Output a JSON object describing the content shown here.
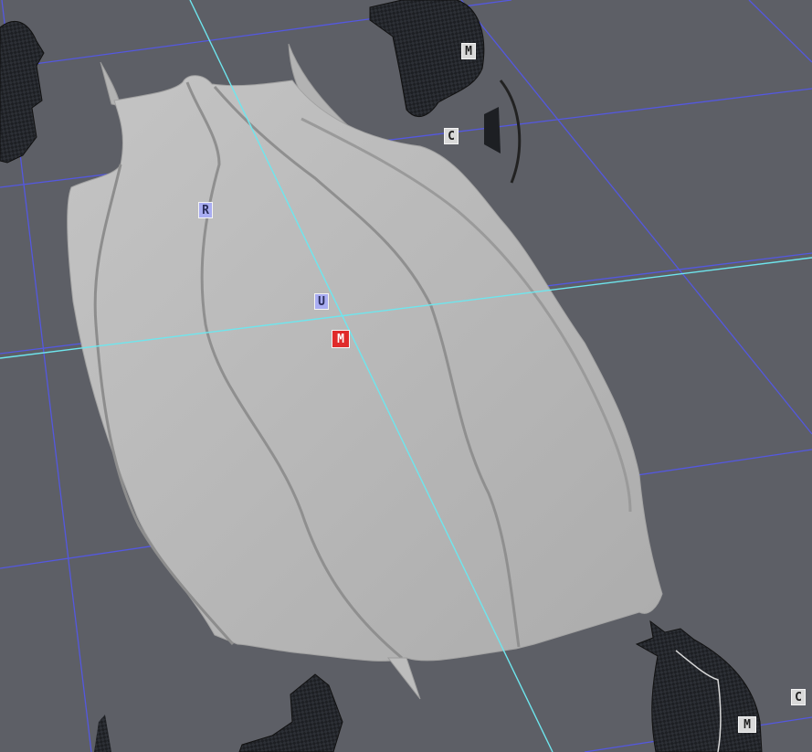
{
  "viewport": {
    "background": "#5d5f66",
    "grid_color": "#5458e0",
    "axis_color": "#6ee6ee",
    "part_color": "#bababa",
    "carbon_color": "#1d1f23"
  },
  "markers": {
    "top_mount": {
      "label": "M",
      "kind": "neutral"
    },
    "top_connector": {
      "label": "C",
      "kind": "neutral"
    },
    "rotate_handle": {
      "label": "R",
      "kind": "blue"
    },
    "up_handle": {
      "label": "U",
      "kind": "blue"
    },
    "center_mount": {
      "label": "M",
      "kind": "selected"
    },
    "bottom_connector": {
      "label": "C",
      "kind": "neutral"
    },
    "bottom_mount": {
      "label": "M",
      "kind": "neutral"
    }
  },
  "marker_styles": {
    "neutral": {
      "bg": "#d9d9d9",
      "fg": "#222222"
    },
    "blue": {
      "bg": "#a9adf2",
      "fg": "#2a2d5a"
    },
    "selected": {
      "bg": "#e02a2a",
      "fg": "#ffffff"
    }
  }
}
